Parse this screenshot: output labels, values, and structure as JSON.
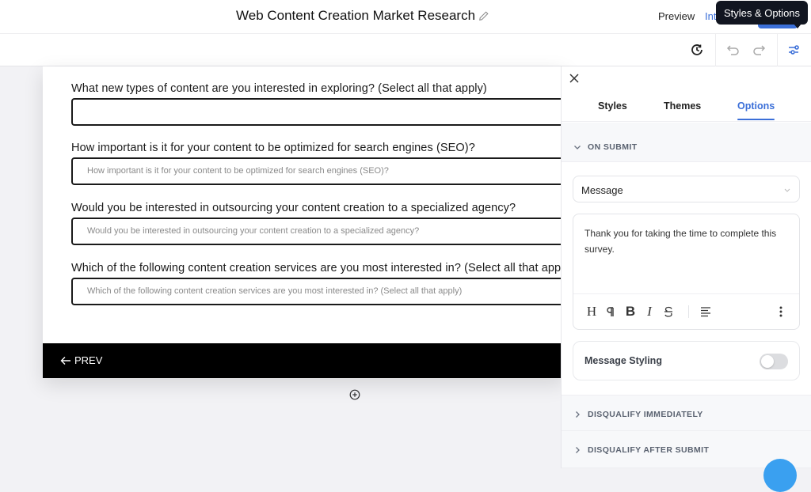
{
  "header": {
    "title": "Web Content Creation Market Research",
    "edit_icon": "pencil-icon",
    "preview_label": "Preview",
    "integrate_label_partial": "Int",
    "tooltip": "Styles & Options"
  },
  "toolbar": {
    "history_icon": "history-clock-icon",
    "undo_icon": "undo-icon",
    "redo_icon": "redo-icon",
    "options_icon": "sliders-icon"
  },
  "form": {
    "questions": [
      {
        "label": "What new types of content are you interested in exploring? (Select all that apply)",
        "placeholder": ""
      },
      {
        "label": "How important is it for your content to be optimized for search engines (SEO)?",
        "placeholder": "How important is it for your content to be optimized for search engines (SEO)?"
      },
      {
        "label": "Would you be interested in outsourcing your content creation to a specialized agency?",
        "placeholder": "Would you be interested in outsourcing your content creation to a specialized agency?"
      },
      {
        "label": "Which of the following content creation services are you most interested in? (Select all that apply)",
        "placeholder": "Which of the following content creation services are you most interested in? (Select all that apply)"
      }
    ],
    "prev_label": "PREV",
    "add_icon": "plus-circle-icon"
  },
  "panel": {
    "tabs": [
      {
        "label": "Styles",
        "active": false
      },
      {
        "label": "Themes",
        "active": false
      },
      {
        "label": "Options",
        "active": true
      }
    ],
    "on_submit": {
      "title": "ON SUBMIT",
      "expanded": true,
      "action_select": "Message",
      "message": "Thank you for taking the time to complete this survey.",
      "editor_tools": [
        "heading",
        "paragraph",
        "bold",
        "italic",
        "strikethrough",
        "align-left",
        "more"
      ],
      "message_styling_label": "Message Styling",
      "message_styling_enabled": false
    },
    "sections": [
      {
        "title": "DISQUALIFY IMMEDIATELY",
        "expanded": false
      },
      {
        "title": "DISQUALIFY AFTER SUBMIT",
        "expanded": false
      }
    ]
  },
  "colors": {
    "accent": "#3b6fd8",
    "footer_bar": "#000000",
    "tooltip_bg": "#111520",
    "fab": "#3aa0f0"
  }
}
